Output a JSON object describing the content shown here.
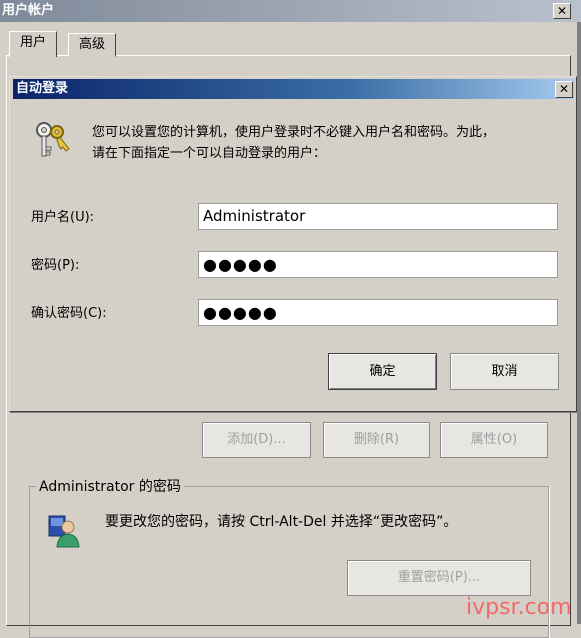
{
  "bg_window": {
    "title": "用户帐户",
    "tabs": [
      "用户",
      "高级"
    ],
    "buttons": {
      "add": "添加(D)...",
      "remove": "删除(R)",
      "properties": "属性(O)"
    },
    "group": {
      "legend": "Administrator 的密码",
      "message": "要更改您的密码，请按 Ctrl-Alt-Del 并选择“更改密码”。",
      "reset_button": "重置密码(P)..."
    }
  },
  "dialog": {
    "title": "自动登录",
    "description_line1": "您可以设置您的计算机，使用户登录时不必键入用户名和密码。为此，",
    "description_line2": "请在下面指定一个可以自动登录的用户：",
    "username_label": "用户名(U):",
    "username_value": "Administrator",
    "password_label": "密码(P):",
    "password_value": "●●●●●",
    "confirm_label": "确认密码(C):",
    "confirm_value": "●●●●●",
    "ok_button": "确定",
    "cancel_button": "取消"
  },
  "close_glyph": "✕",
  "watermark": "ivpsr.com"
}
